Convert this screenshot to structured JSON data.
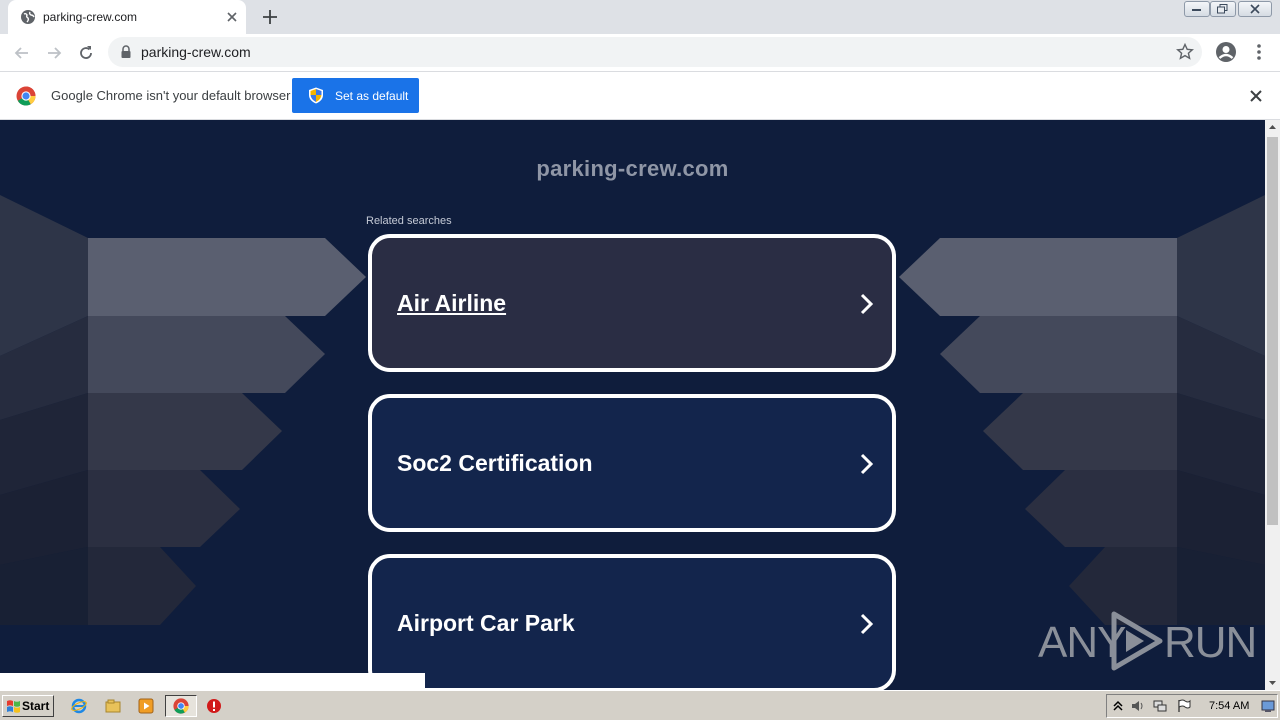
{
  "browser": {
    "tab_title": "parking-crew.com",
    "url": "parking-crew.com"
  },
  "infobar": {
    "message": "Google Chrome isn't your default browser",
    "button_label": "Set as default"
  },
  "page": {
    "domain_title": "parking-crew.com",
    "related_label": "Related searches",
    "searches": [
      {
        "label": "Air Airline"
      },
      {
        "label": "Soc2 Certification"
      },
      {
        "label": "Airport Car Park"
      }
    ],
    "watermark": {
      "left": "ANY",
      "right": "RUN"
    }
  },
  "taskbar": {
    "start_label": "Start",
    "clock": "7:54 AM"
  },
  "colors": {
    "page_bg": "#0f1d3c",
    "card_hover": "#2a2d44",
    "card": "#13254c",
    "chrome_blue": "#1a73e8"
  }
}
